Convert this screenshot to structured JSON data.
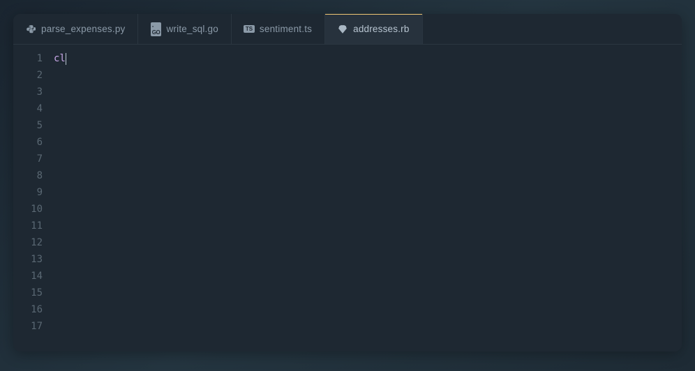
{
  "tabs": [
    {
      "label": "parse_expenses.py",
      "icon": "python-icon",
      "active": false
    },
    {
      "label": "write_sql.go",
      "icon": "go-icon",
      "active": false
    },
    {
      "label": "sentiment.ts",
      "icon": "typescript-icon",
      "active": false
    },
    {
      "label": "addresses.rb",
      "icon": "ruby-icon",
      "active": true
    }
  ],
  "editor": {
    "line_count": 17,
    "lines": {
      "1": "cl"
    },
    "cursor_line": 1,
    "cursor_col": 2
  },
  "line_numbers": [
    "1",
    "2",
    "3",
    "4",
    "5",
    "6",
    "7",
    "8",
    "9",
    "10",
    "11",
    "12",
    "13",
    "14",
    "15",
    "16",
    "17"
  ]
}
